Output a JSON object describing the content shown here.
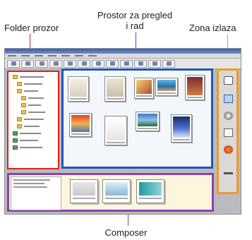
{
  "callouts": {
    "folder": "Folder prozor",
    "browse": "Prostor za pregled i rad",
    "output": "Zona izlaza",
    "composer": "Composer"
  },
  "colors": {
    "folder_frame": "#e2231a",
    "browse_frame": "#1f57b8",
    "output_frame": "#f39a1e",
    "composer_frame": "#8e3fb5"
  },
  "toolbar": {
    "buttons": [
      "back-icon",
      "forward-icon",
      "up-icon",
      "refresh-icon",
      "print-icon",
      "email-icon",
      "slideshow-icon",
      "view-icon",
      "properties-icon",
      "web-icon",
      "zoom-icon",
      "help-icon"
    ]
  },
  "output_zone": {
    "icons": [
      "print-output-icon",
      "email-output-icon",
      "burn-cd-icon",
      "document-output-icon",
      "web-output-icon",
      "clear-icon"
    ]
  }
}
